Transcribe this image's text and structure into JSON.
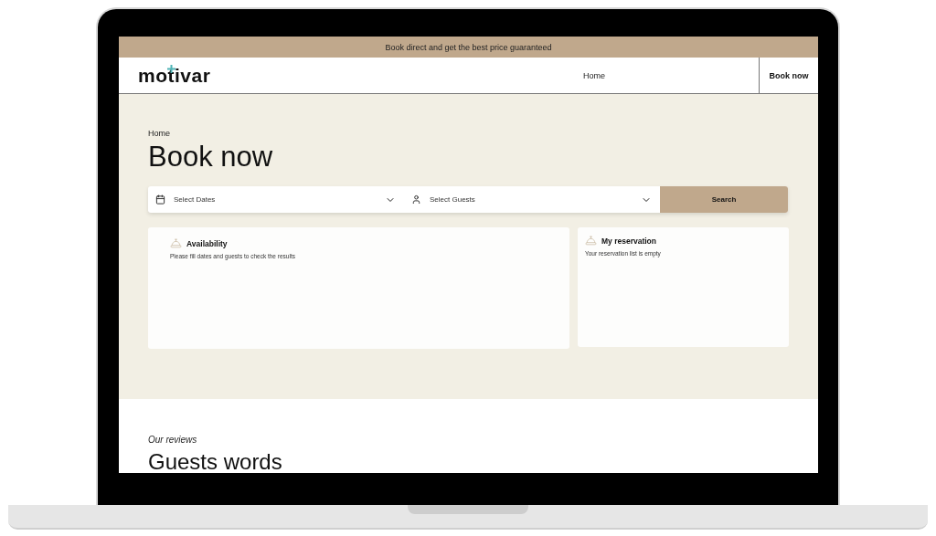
{
  "banner": "Book direct and get the best price guaranteed",
  "header": {
    "logo": "motivar",
    "nav": [
      {
        "label": "Home"
      }
    ],
    "cta": "Book now"
  },
  "hero": {
    "breadcrumb": "Home",
    "title": "Book now",
    "search": {
      "dates": {
        "placeholder": "Select Dates"
      },
      "guests": {
        "placeholder": "Select Guests"
      },
      "button": "Search"
    },
    "cards": [
      {
        "title": "Availability",
        "text": "Please fill dates and guests to check the results"
      },
      {
        "title": "My reservation",
        "text": "Your reservation list is empty"
      }
    ]
  },
  "reviews": {
    "eyebrow": "Our reviews",
    "title": "Guests words"
  }
}
